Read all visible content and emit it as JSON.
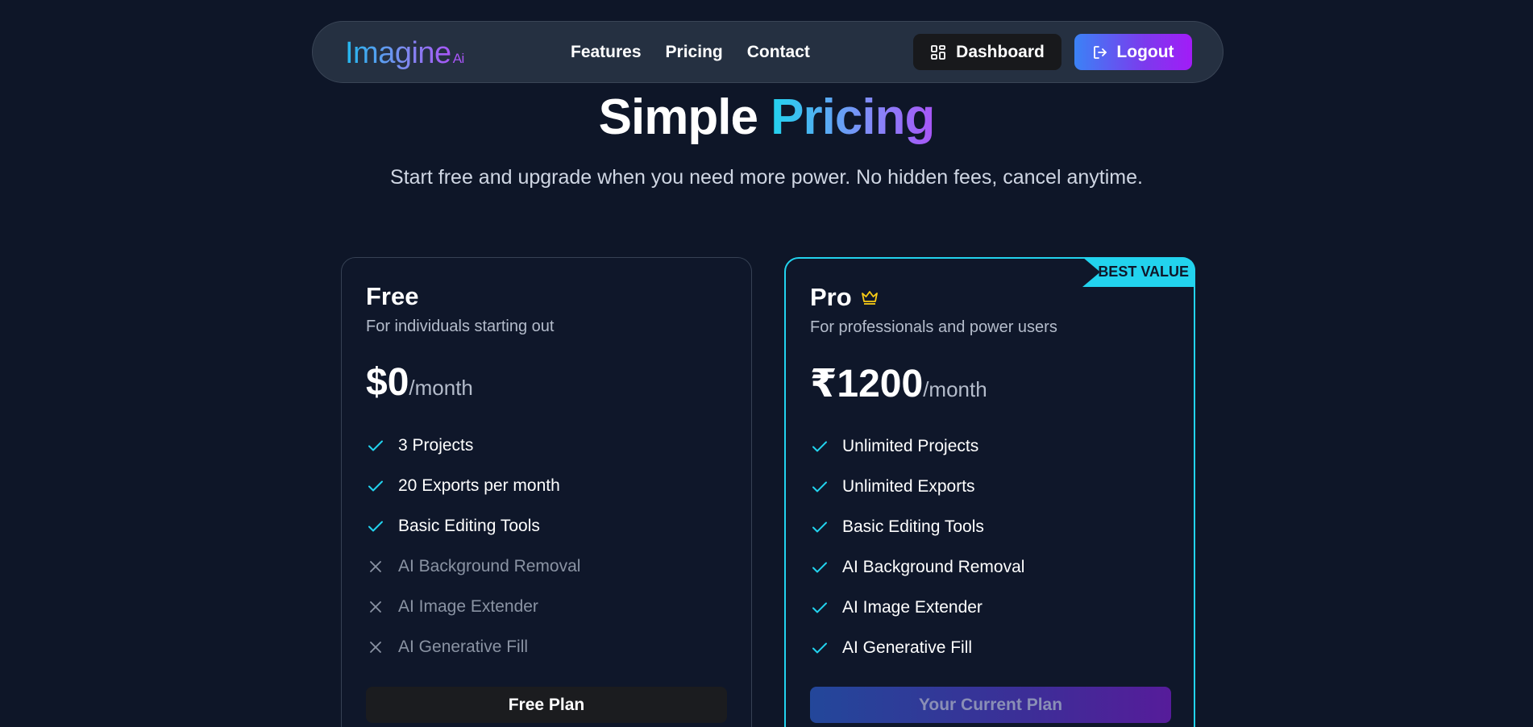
{
  "nav": {
    "logo_main": "Imagine",
    "logo_sup": "Ai",
    "links": [
      "Features",
      "Pricing",
      "Contact"
    ],
    "dashboard_label": "Dashboard",
    "logout_label": "Logout",
    "dashboard_icon": "grid-icon",
    "logout_icon": "logout-icon"
  },
  "hero": {
    "title_plain": "Simple",
    "title_accent": "Pricing",
    "subtitle": "Start free and upgrade when you need more power. No hidden fees, cancel anytime."
  },
  "plans": [
    {
      "name": "Free",
      "description": "For individuals starting out",
      "price": "$0",
      "period": "/month",
      "button_label": "Free Plan",
      "features": [
        {
          "label": "3 Projects",
          "included": true
        },
        {
          "label": "20 Exports per month",
          "included": true
        },
        {
          "label": "Basic Editing Tools",
          "included": true
        },
        {
          "label": "AI Background Removal",
          "included": false
        },
        {
          "label": "AI Image Extender",
          "included": false
        },
        {
          "label": "AI Generative Fill",
          "included": false
        }
      ]
    },
    {
      "name": "Pro",
      "description": "For professionals and power users",
      "price": "₹1200",
      "period": "/month",
      "badge": "BEST VALUE",
      "button_label": "Your Current Plan",
      "icon": "crown-icon",
      "features": [
        {
          "label": "Unlimited Projects",
          "included": true
        },
        {
          "label": "Unlimited Exports",
          "included": true
        },
        {
          "label": "Basic Editing Tools",
          "included": true
        },
        {
          "label": "AI Background Removal",
          "included": true
        },
        {
          "label": "AI Image Extender",
          "included": true
        },
        {
          "label": "AI Generative Fill",
          "included": true
        }
      ]
    }
  ],
  "colors": {
    "background": "#0e1628",
    "accent_cyan": "#22d3ee",
    "accent_purple": "#a855f7",
    "check": "#22d3ee",
    "crown": "#facc15"
  }
}
